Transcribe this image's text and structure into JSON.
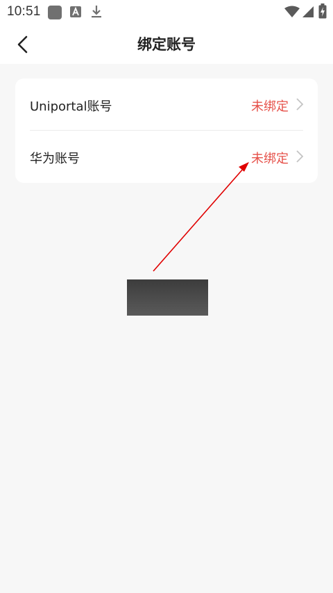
{
  "status_bar": {
    "time": "10:51",
    "icons": [
      "app-square-icon",
      "keyboard-a-icon",
      "download-icon",
      "wifi-icon",
      "signal-icon",
      "battery-charging-icon"
    ]
  },
  "header": {
    "title": "绑定账号",
    "back_icon": "chevron-left-icon"
  },
  "accounts": [
    {
      "label": "Uniportal账号",
      "status": "未绑定"
    },
    {
      "label": "华为账号",
      "status": "未绑定"
    }
  ],
  "colors": {
    "status_unbound": "#e6514a",
    "annotation_arrow": "#e00000",
    "background": "#f7f7f7"
  }
}
